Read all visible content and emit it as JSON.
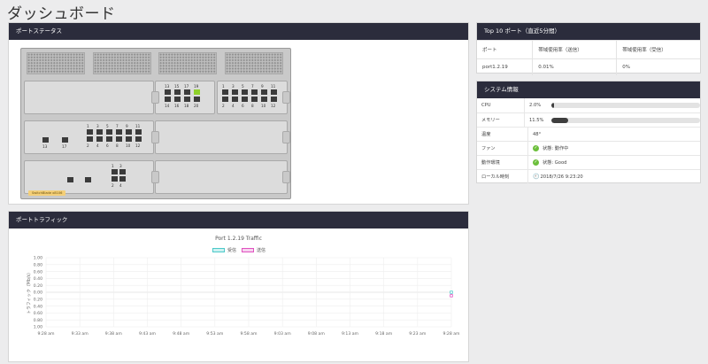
{
  "page": {
    "title": "ダッシュボード"
  },
  "port_status": {
    "title": "ポートステータス",
    "device_label": "SwitchBlade x8106",
    "slot_right": {
      "top_labels": [
        "1",
        "3",
        "5",
        "7",
        "9",
        "11"
      ],
      "bottom_labels": [
        "2",
        "4",
        "6",
        "8",
        "10",
        "12"
      ]
    },
    "slot_mid": {
      "top_labels": [
        "13",
        "15",
        "17",
        "19"
      ],
      "bottom_labels": [
        "14",
        "16",
        "18",
        "20"
      ],
      "active_port": "19"
    },
    "slot_left": {
      "top_labels": [
        "1",
        "3",
        "5",
        "7",
        "9",
        "11"
      ],
      "bottom_labels": [
        "2",
        "4",
        "6",
        "8",
        "10",
        "12"
      ],
      "single_labels": [
        "13",
        "17"
      ]
    },
    "slot_bottom": {
      "top_labels": [
        "1",
        "3"
      ],
      "bottom_labels": [
        "2",
        "4"
      ]
    }
  },
  "traffic": {
    "title": "ポートトラフィック",
    "legend": [
      {
        "label": "受信",
        "color": "#4dc9c9",
        "fill": "#cdf1f1"
      },
      {
        "label": "送信",
        "color": "#e052c0",
        "fill": "#f6d3ef"
      }
    ]
  },
  "chart_data": {
    "type": "line",
    "title": "Port 1.2.19 Traffic",
    "ylabel": "トラフィック（Mb/s）",
    "xlabel": "",
    "x": [
      "9:28 am",
      "9:33 am",
      "9:38 am",
      "9:43 am",
      "9:48 am",
      "9:53 am",
      "9:58 am",
      "9:03 am",
      "9:08 am",
      "9:13 am",
      "9:18 am",
      "9:23 am",
      "9:28 am"
    ],
    "yticks": [
      "1.00",
      "0.80",
      "0.60",
      "0.40",
      "0.20",
      "0.00",
      "0.20",
      "0.40",
      "0.60",
      "0.80",
      "1.00"
    ],
    "ylim": [
      -1,
      1
    ],
    "grid": true,
    "legend_position": "top",
    "series": [
      {
        "name": "受信",
        "values": [
          null,
          null,
          null,
          null,
          null,
          null,
          null,
          null,
          null,
          null,
          null,
          null,
          0.0
        ],
        "color": "#4dc9c9"
      },
      {
        "name": "送信",
        "values": [
          null,
          null,
          null,
          null,
          null,
          null,
          null,
          null,
          null,
          null,
          null,
          null,
          -0.1
        ],
        "color": "#e052c0"
      }
    ]
  },
  "top10": {
    "title": "Top 10 ポート（直近5分間）",
    "headers": [
      "ポート",
      "帯域使用率（送信）",
      "帯域使用率（受信）"
    ],
    "rows": [
      [
        "port1.2.19",
        "0.01%",
        "0%"
      ]
    ]
  },
  "system": {
    "title": "システム情報",
    "cpu": {
      "label": "CPU",
      "value": "2.0%",
      "fraction": 0.02
    },
    "memory": {
      "label": "メモリー",
      "value": "11.5%",
      "fraction": 0.115
    },
    "temp": {
      "label": "温度",
      "value": "48°"
    },
    "fan": {
      "label": "ファン",
      "value": "状態: 動作中"
    },
    "env": {
      "label": "動作環境",
      "value": "状態: Good"
    },
    "time": {
      "label": "ローカル時刻",
      "value": "2018/7/26 9:23:20"
    }
  }
}
